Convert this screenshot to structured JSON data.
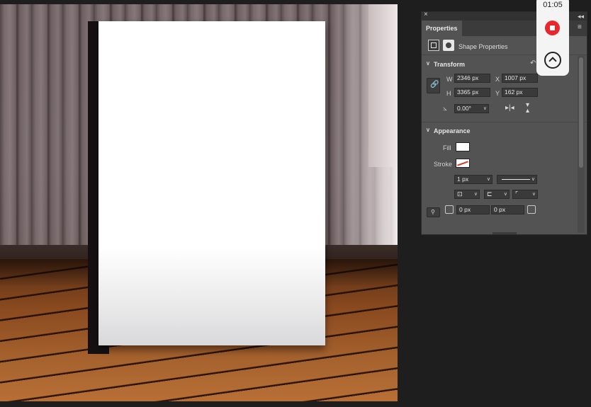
{
  "panel": {
    "close_glyph": "×",
    "tab_label": "Properties",
    "menu_glyph": "≡",
    "shape_properties_label": "Shape Properties"
  },
  "transform": {
    "title": "Transform",
    "w_label": "W",
    "w_value": "2346 px",
    "h_label": "H",
    "h_value": "3365 px",
    "x_label": "X",
    "x_value": "1007 px",
    "y_label": "Y",
    "y_value": "162 px",
    "angle_value": "0.00°",
    "link_icon": "link-icon",
    "reset_icon": "reset-icon",
    "flip_h_icon": "flip-horizontal-icon",
    "flip_v_icon": "flip-vertical-icon"
  },
  "appearance": {
    "title": "Appearance",
    "fill_label": "Fill",
    "fill_color": "#ffffff",
    "stroke_label": "Stroke",
    "stroke_width": "1 px",
    "corner_1": "0 px",
    "corner_2": "0 px"
  },
  "recorder": {
    "time": "01:05",
    "stop_color": "#e8262b"
  },
  "colors": {
    "panel_bg": "#535353",
    "app_bg": "#1e1e1e"
  }
}
